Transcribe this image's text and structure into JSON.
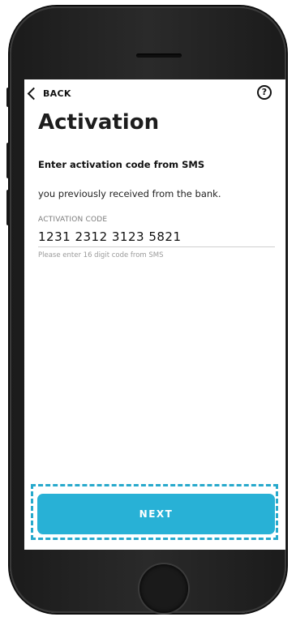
{
  "nav": {
    "back_label": "BACK",
    "help_icon": "help-circle-icon",
    "help_glyph": "?"
  },
  "page": {
    "title": "Activation",
    "subtitle": "Enter activation code from SMS",
    "description": "you previously received from the bank."
  },
  "activation_field": {
    "label": "ACTIVATION CODE",
    "value": "1231 2312 3123 5821",
    "helper": "Please enter 16 digit code from SMS"
  },
  "actions": {
    "next_label": "NEXT"
  },
  "colors": {
    "accent": "#28b1d6",
    "focus_outline": "#27a9cc",
    "phone_body": "#1b1b1b"
  }
}
